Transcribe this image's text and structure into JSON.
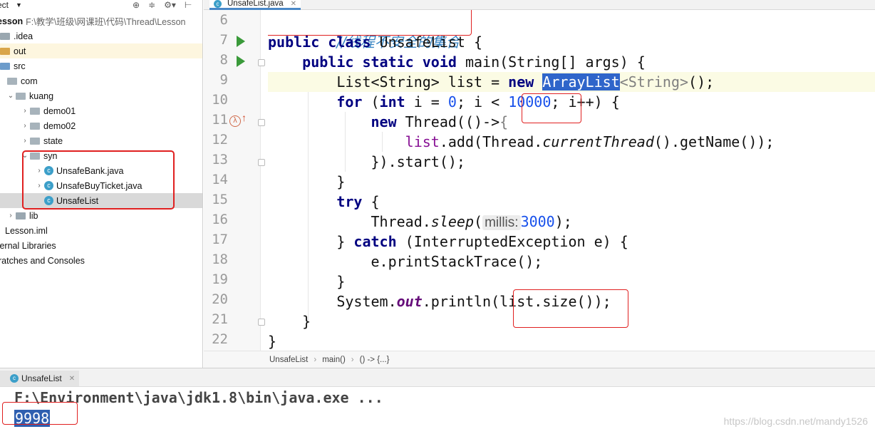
{
  "project_panel": {
    "title": "ect",
    "tree": [
      {
        "label": "esson",
        "path": "F:\\教学\\班级\\网课班\\代码\\Thread\\Lesson",
        "kind": "module"
      },
      {
        "label": ".idea",
        "kind": "folder"
      },
      {
        "label": "out",
        "kind": "folder"
      },
      {
        "label": "src",
        "kind": "folder"
      },
      {
        "label": "com",
        "kind": "package"
      },
      {
        "label": "kuang",
        "kind": "package"
      },
      {
        "label": "demo01",
        "kind": "package"
      },
      {
        "label": "demo02",
        "kind": "package"
      },
      {
        "label": "state",
        "kind": "package"
      },
      {
        "label": "syn",
        "kind": "package"
      },
      {
        "label": "UnsafeBank.java",
        "kind": "class"
      },
      {
        "label": "UnsafeBuyTicket.java",
        "kind": "class"
      },
      {
        "label": "UnsafeList",
        "kind": "class"
      },
      {
        "label": "lib",
        "kind": "folder"
      },
      {
        "label": "Lesson.iml",
        "kind": "file"
      },
      {
        "label": "ternal Libraries",
        "kind": "library"
      },
      {
        "label": "ratches and Consoles",
        "kind": "scratch"
      }
    ]
  },
  "editor": {
    "tab_label": "UnsafeList.java",
    "line_numbers": [
      "6",
      "7",
      "8",
      "9",
      "10",
      "11",
      "12",
      "13",
      "14",
      "15",
      "16",
      "17",
      "18",
      "19",
      "20",
      "21",
      "22"
    ],
    "comment": "//线程不安全的集合",
    "code": {
      "l7": {
        "kw1": "public",
        "kw2": "class",
        "rest": " UnsafeList {"
      },
      "l8": {
        "kw1": "public",
        "kw2": "static",
        "kw3": "void",
        "rest": " main(String[] args) {"
      },
      "l9": {
        "pre": "List<String> list = ",
        "kw": "new",
        "sel": "ArrayList",
        "gen": "<String>",
        "post": "();"
      },
      "l10": {
        "kw": "for",
        "a": " (",
        "kw2": "int",
        "b": " i = ",
        "n0": "0",
        "c": "; i < ",
        "n1": "10000",
        "d": "; i++) {"
      },
      "l11": {
        "kw": "new",
        "a": " Thread(()->",
        "b": "{"
      },
      "l12": {
        "a": "list",
        "b": ".add(Thread.",
        "c": "currentThread",
        "d": "().getName());"
      },
      "l13": {
        "a": "}).start();"
      },
      "l14": {
        "a": "}"
      },
      "l15": {
        "kw": "try",
        "a": " {"
      },
      "l16": {
        "a": "Thread.",
        "b": "sleep",
        "c": "(",
        "hint": "millis:",
        "n": "3000",
        "d": ");"
      },
      "l17": {
        "a": "} ",
        "kw": "catch",
        "b": " (InterruptedException e) {"
      },
      "l18": {
        "a": "e.printStackTrace();"
      },
      "l19": {
        "a": "}"
      },
      "l20": {
        "a": "System.",
        "f": "out",
        "b": ".println(list.size());"
      },
      "l21": {
        "a": "}"
      },
      "l22": {
        "a": "}"
      }
    },
    "breadcrumbs": [
      "UnsafeList",
      "main()",
      "() -> {...}"
    ]
  },
  "run_panel": {
    "tab_label": "UnsafeList",
    "command": "F:\\Environment\\java\\jdk1.8\\bin\\java.exe ...",
    "output": "9998",
    "watermark": "https://blog.csdn.net/mandy1526"
  }
}
